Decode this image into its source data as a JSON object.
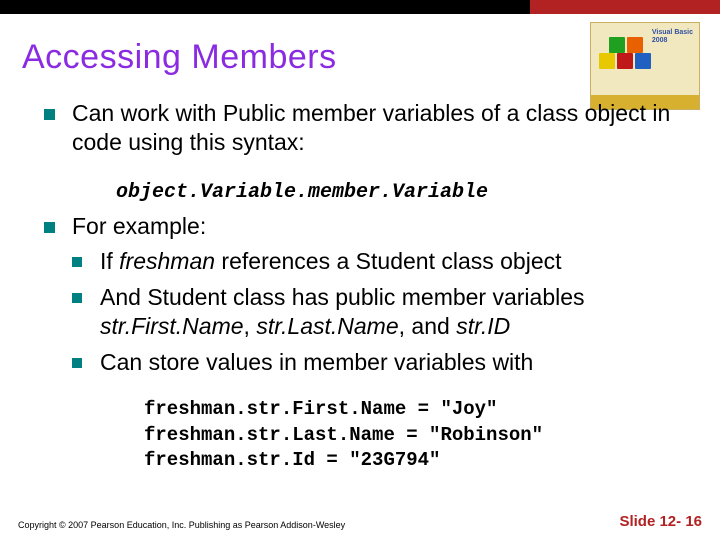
{
  "title": "Accessing Members",
  "bullets": {
    "b1": "Can work with Public member variables of a class object in code using this syntax:",
    "code1": "object.Variable.member.Variable",
    "b2": "For example:",
    "sub1_pre": "If ",
    "sub1_it": "freshman",
    "sub1_post": " references a Student class object",
    "sub2_pre": "And Student class has public member variables ",
    "sub2_it1": "str.First.Name",
    "sub2_mid1": ", ",
    "sub2_it2": "str.Last.Name",
    "sub2_mid2": ", and ",
    "sub2_it3": "str.ID",
    "sub3": "Can store values in member variables with",
    "code2a": "freshman.str.First.Name = \"Joy\"",
    "code2b": "freshman.str.Last.Name = \"Robinson\"",
    "code2c": "freshman.str.Id = \"23G794\""
  },
  "footer": {
    "copyright": "Copyright © 2007 Pearson Education, Inc. Publishing as Pearson Addison-Wesley",
    "slidenum": "Slide 12- 16"
  },
  "book": {
    "line1": "Visual Basic",
    "line2": "2008"
  }
}
